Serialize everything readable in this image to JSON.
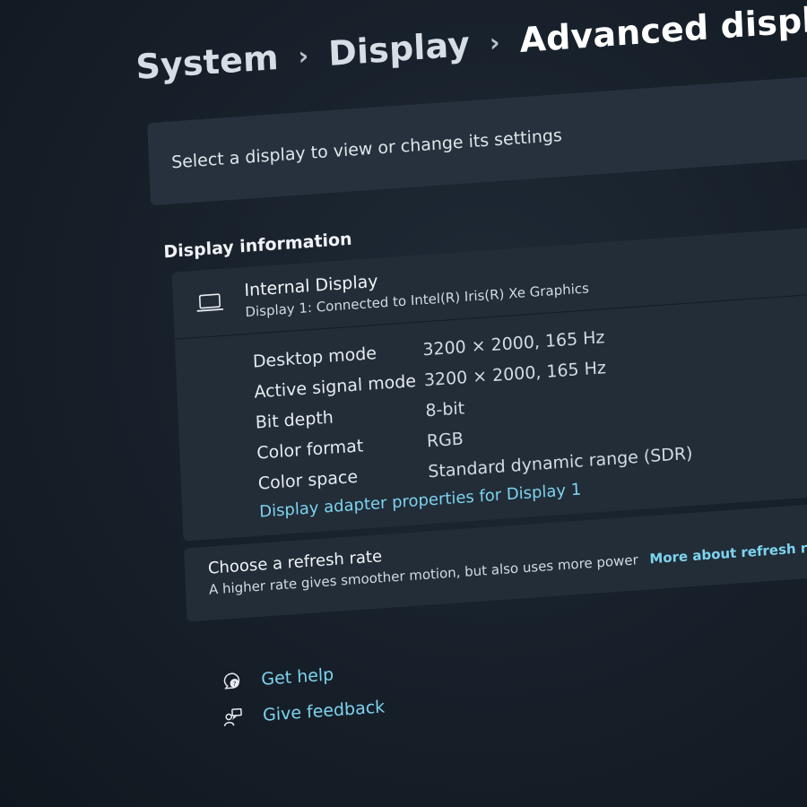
{
  "breadcrumb": {
    "items": [
      "System",
      "Display"
    ],
    "current": "Advanced display",
    "separator": "›"
  },
  "select_display": {
    "label": "Select a display to view or change its settings"
  },
  "display_information": {
    "section_title": "Display information",
    "name": "Internal Display",
    "connection": "Display 1: Connected to Intel(R) Iris(R) Xe Graphics",
    "icon": "laptop-icon",
    "properties": [
      {
        "label": "Desktop mode",
        "value": "3200 × 2000, 165 Hz"
      },
      {
        "label": "Active signal mode",
        "value": "3200 × 2000, 165 Hz"
      },
      {
        "label": "Bit depth",
        "value": "8-bit"
      },
      {
        "label": "Color format",
        "value": "RGB"
      },
      {
        "label": "Color space",
        "value": "Standard dynamic range (SDR)"
      }
    ],
    "adapter_link": "Display adapter properties for Display 1"
  },
  "refresh_rate": {
    "title": "Choose a refresh rate",
    "description": "A higher rate gives smoother motion, but also uses more power",
    "more_link": "More about refresh rate"
  },
  "help_links": {
    "get_help": "Get help",
    "give_feedback": "Give feedback"
  },
  "colors": {
    "accent_link": "#7ed3ef",
    "card_background": "#222d38",
    "page_background": "#18212b"
  }
}
